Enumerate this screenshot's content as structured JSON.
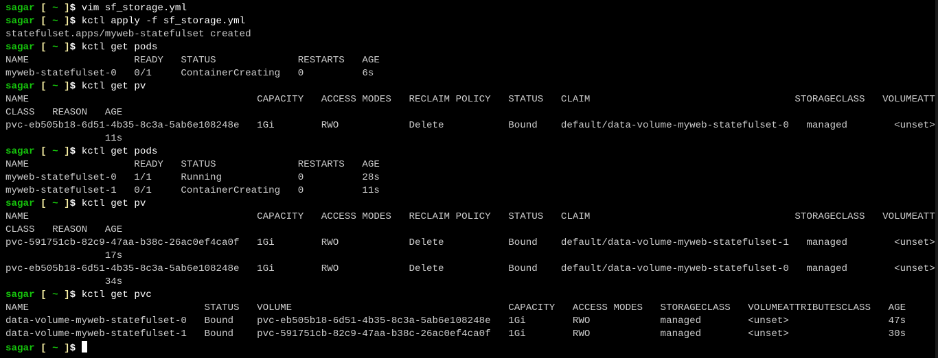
{
  "colors": {
    "background": "#000000",
    "prompt_user": "#16c60c",
    "prompt_bracket": "#f9f1a5",
    "command": "#ffffff",
    "output": "#cccccc"
  },
  "prompt": {
    "user": "sagar",
    "open": "[",
    "path": "~",
    "close": "]",
    "symbol": "$"
  },
  "lines": [
    {
      "type": "prompt",
      "command": "vim sf_storage.yml"
    },
    {
      "type": "prompt",
      "command": "kctl apply -f sf_storage.yml"
    },
    {
      "type": "output",
      "text": "statefulset.apps/myweb-statefulset created"
    },
    {
      "type": "prompt",
      "command": "kctl get pods"
    },
    {
      "type": "output",
      "text": "NAME                  READY   STATUS              RESTARTS   AGE"
    },
    {
      "type": "output",
      "text": "myweb-statefulset-0   0/1     ContainerCreating   0          6s"
    },
    {
      "type": "prompt",
      "command": "kctl get pv"
    },
    {
      "type": "output",
      "text": "NAME                                       CAPACITY   ACCESS MODES   RECLAIM POLICY   STATUS   CLAIM                                   STORAGECLASS   VOLUMEATTRIBUTES"
    },
    {
      "type": "output",
      "text": "CLASS   REASON   AGE"
    },
    {
      "type": "output",
      "text": "pvc-eb505b18-6d51-4b35-8c3a-5ab6e108248e   1Gi        RWO            Delete           Bound    default/data-volume-myweb-statefulset-0   managed        <unset>"
    },
    {
      "type": "output",
      "text": "                 11s"
    },
    {
      "type": "prompt",
      "command": "kctl get pods"
    },
    {
      "type": "output",
      "text": "NAME                  READY   STATUS              RESTARTS   AGE"
    },
    {
      "type": "output",
      "text": "myweb-statefulset-0   1/1     Running             0          28s"
    },
    {
      "type": "output",
      "text": "myweb-statefulset-1   0/1     ContainerCreating   0          11s"
    },
    {
      "type": "prompt",
      "command": "kctl get pv"
    },
    {
      "type": "output",
      "text": "NAME                                       CAPACITY   ACCESS MODES   RECLAIM POLICY   STATUS   CLAIM                                   STORAGECLASS   VOLUMEATTRIBUTES"
    },
    {
      "type": "output",
      "text": "CLASS   REASON   AGE"
    },
    {
      "type": "output",
      "text": "pvc-591751cb-82c9-47aa-b38c-26ac0ef4ca0f   1Gi        RWO            Delete           Bound    default/data-volume-myweb-statefulset-1   managed        <unset>"
    },
    {
      "type": "output",
      "text": "                 17s"
    },
    {
      "type": "output",
      "text": "pvc-eb505b18-6d51-4b35-8c3a-5ab6e108248e   1Gi        RWO            Delete           Bound    default/data-volume-myweb-statefulset-0   managed        <unset>"
    },
    {
      "type": "output",
      "text": "                 34s"
    },
    {
      "type": "prompt",
      "command": "kctl get pvc"
    },
    {
      "type": "output",
      "text": "NAME                              STATUS   VOLUME                                     CAPACITY   ACCESS MODES   STORAGECLASS   VOLUMEATTRIBUTESCLASS   AGE"
    },
    {
      "type": "output",
      "text": "data-volume-myweb-statefulset-0   Bound    pvc-eb505b18-6d51-4b35-8c3a-5ab6e108248e   1Gi        RWO            managed        <unset>                 47s"
    },
    {
      "type": "output",
      "text": "data-volume-myweb-statefulset-1   Bound    pvc-591751cb-82c9-47aa-b38c-26ac0ef4ca0f   1Gi        RWO            managed        <unset>                 30s"
    },
    {
      "type": "prompt",
      "command": "",
      "cursor": true
    }
  ]
}
